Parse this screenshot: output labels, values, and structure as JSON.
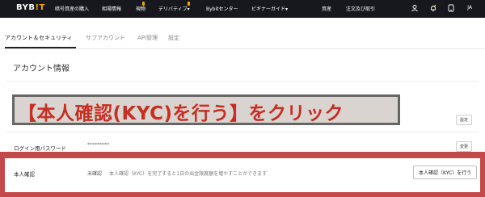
{
  "header": {
    "logo_main": "BYB",
    "logo_accent": "!T",
    "nav": [
      "暗号資産の購入",
      "相場情報",
      "現物",
      "デリバティブ▾",
      "Bybitセンター",
      "ビギナーガイド▾"
    ],
    "right": [
      "資産",
      "注文及び取引"
    ],
    "avatar": "JA"
  },
  "tabs": [
    "アカウント＆セキュリティ",
    "サブアカウント",
    "API管理",
    "設定"
  ],
  "section_title": "アカウント情報",
  "overlay_text": "【本人確認(KYC)を行う】をクリック",
  "rows": {
    "setting_button": "設定",
    "password_label": "ログイン用パスワード",
    "password_value": "*********",
    "change_button": "変更"
  },
  "kyc": {
    "label": "本人確認",
    "status": "未確認",
    "description": "本人確認（KYC）を完了すると1日の出金限度額を増やすことができます",
    "button": "本人確認（KYC）を行う"
  },
  "colors": {
    "topbar": "#17181e",
    "accent": "#f7a600",
    "highlight": "#c3494b",
    "overlay_text": "#c62f22"
  }
}
